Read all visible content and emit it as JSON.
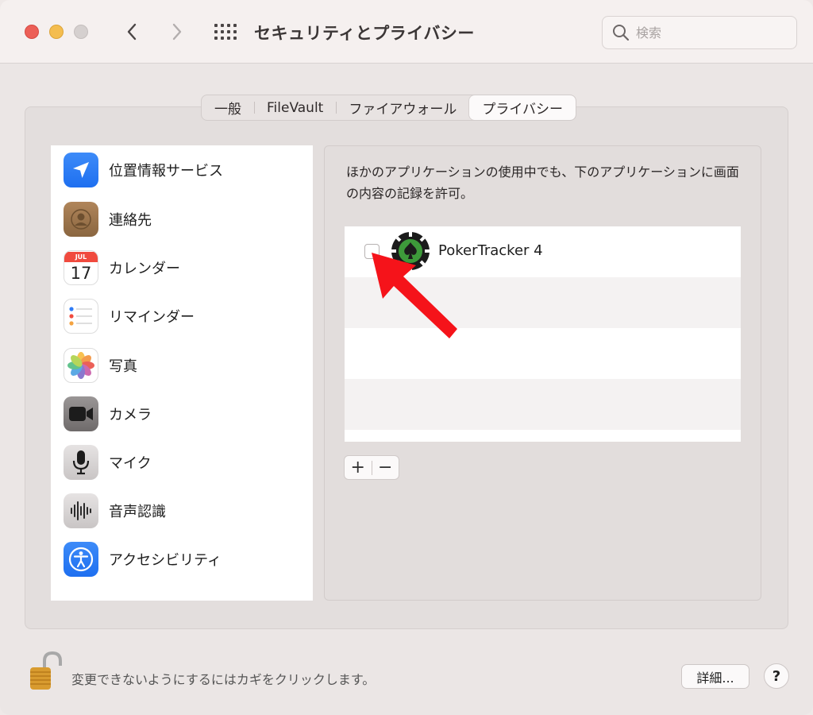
{
  "window": {
    "title": "セキュリティとプライバシー"
  },
  "search": {
    "placeholder": "検索"
  },
  "tabs": [
    {
      "label": "一般"
    },
    {
      "label": "FileVault"
    },
    {
      "label": "ファイアウォール"
    },
    {
      "label": "プライバシー",
      "active": true
    }
  ],
  "sidebar": {
    "items": [
      {
        "label": "位置情報サービス",
        "icon": "location-arrow-icon"
      },
      {
        "label": "連絡先",
        "icon": "contacts-icon"
      },
      {
        "label": "カレンダー",
        "icon": "calendar-icon"
      },
      {
        "label": "リマインダー",
        "icon": "reminders-icon"
      },
      {
        "label": "写真",
        "icon": "photos-icon"
      },
      {
        "label": "カメラ",
        "icon": "camera-icon"
      },
      {
        "label": "マイク",
        "icon": "microphone-icon"
      },
      {
        "label": "音声認識",
        "icon": "speech-recognition-icon"
      },
      {
        "label": "アクセシビリティ",
        "icon": "accessibility-icon"
      }
    ]
  },
  "calendar_icon": {
    "month": "JUL",
    "day": "17"
  },
  "content": {
    "description": "ほかのアプリケーションの使用中でも、下のアプリケーションに画面の内容の記録を許可。",
    "apps": [
      {
        "name": "PokerTracker 4",
        "checked": false,
        "icon": "poker-chip-icon"
      }
    ]
  },
  "list_controls": {
    "add": "+",
    "remove": "−"
  },
  "footer": {
    "lock_text": "変更できないようにするにはカギをクリックします。",
    "detail_button": "詳細...",
    "help_button": "?"
  },
  "colors": {
    "close": "#ec5f57",
    "minimize": "#f4bd4f",
    "annotation_arrow": "#f5131a",
    "location_blue": "#2f7cf6"
  }
}
